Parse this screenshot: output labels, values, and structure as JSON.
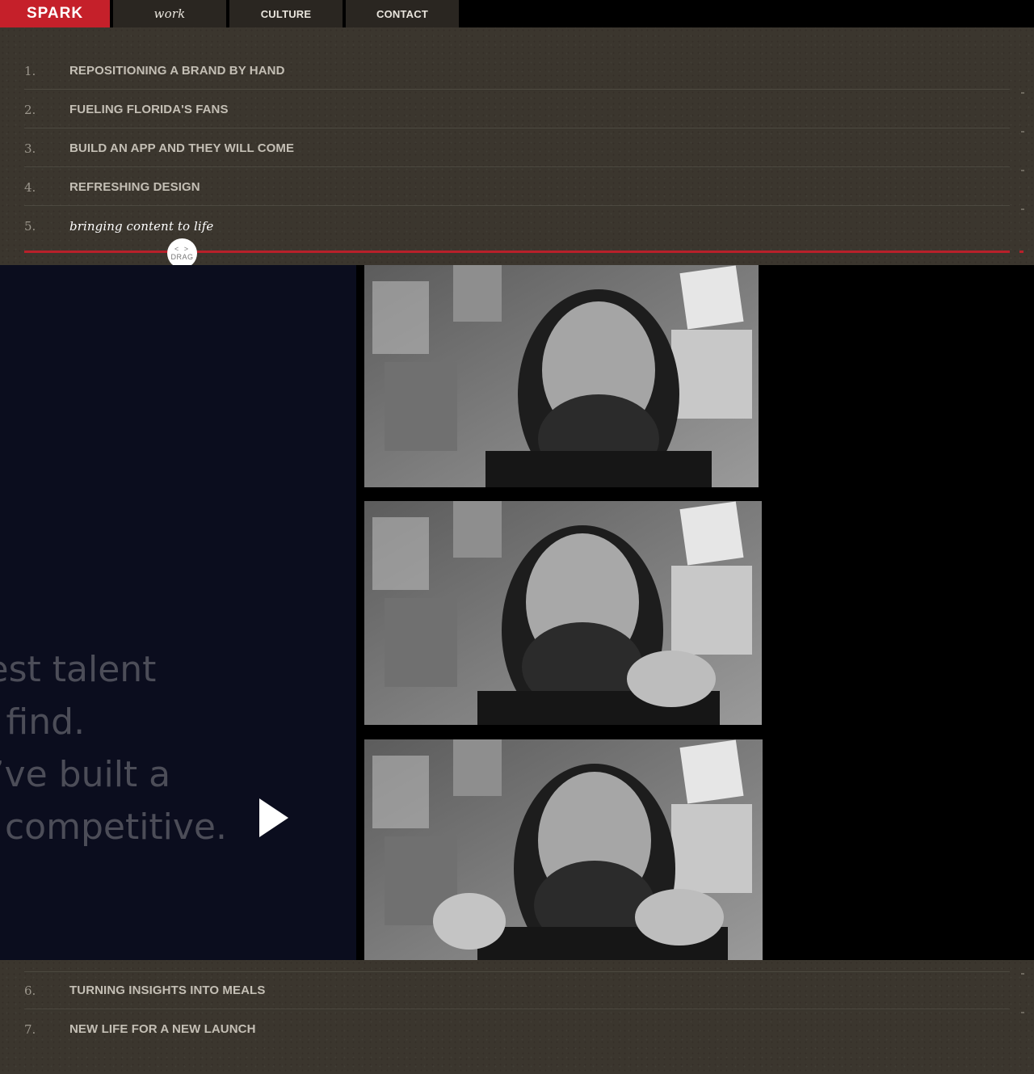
{
  "nav": {
    "logo": "SPARK",
    "tabs": [
      {
        "label": "work"
      },
      {
        "label": "CULTURE"
      },
      {
        "label": "CONTACT"
      }
    ]
  },
  "projects": [
    {
      "num": "1.",
      "title": "REPOSITIONING A BRAND BY HAND"
    },
    {
      "num": "2.",
      "title": "FUELING FLORIDA'S FANS"
    },
    {
      "num": "3.",
      "title": "BUILD AN APP AND THEY WILL COME"
    },
    {
      "num": "4.",
      "title": "REFRESHING DESIGN"
    },
    {
      "num": "5.",
      "title": "bringing content to life"
    },
    {
      "num": "6.",
      "title": "TURNING INSIGHTS INTO MEALS"
    },
    {
      "num": "7.",
      "title": "NEW LIFE FOR A NEW LAUNCH"
    }
  ],
  "drag": {
    "arrows": "< >",
    "label": "DRAG"
  },
  "quote": {
    "lines": [
      "e best talent",
      "can find.",
      " we’ve built a",
      "ally competitive."
    ]
  },
  "colors": {
    "accent": "#c5202a",
    "panel": "#0b0d1e"
  }
}
